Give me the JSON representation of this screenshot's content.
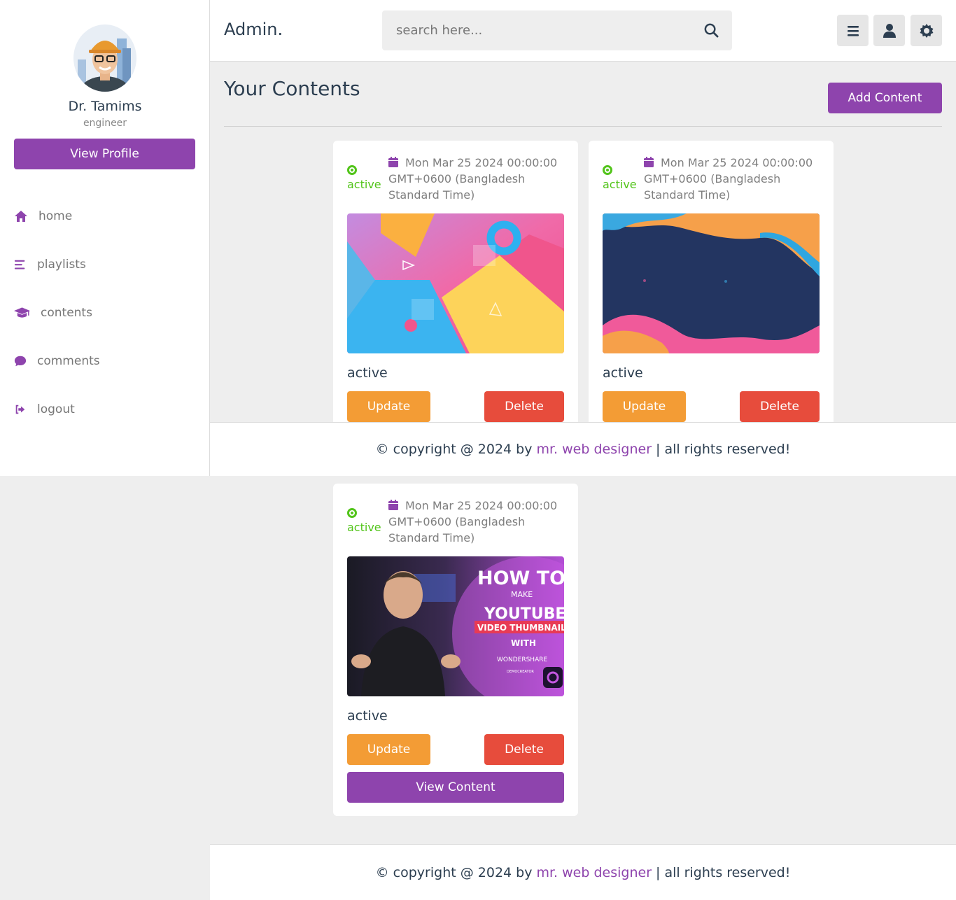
{
  "sidebar": {
    "profile_name": "Dr. Tamims",
    "profile_role": "engineer",
    "view_profile_label": "View Profile",
    "nav": [
      {
        "label": "home",
        "icon": "home-icon"
      },
      {
        "label": "playlists",
        "icon": "list-icon"
      },
      {
        "label": "contents",
        "icon": "graduation-cap-icon"
      },
      {
        "label": "comments",
        "icon": "comment-icon"
      },
      {
        "label": "logout",
        "icon": "logout-icon"
      }
    ]
  },
  "header": {
    "logo": "Admin.",
    "search_placeholder": "search here...",
    "buttons": [
      "menu-icon",
      "user-icon",
      "settings-icon"
    ]
  },
  "main": {
    "title": "Your Contents",
    "add_content_label": "Add Content",
    "cards": [
      {
        "status": "active",
        "date": "Mon Mar 25 2024 00:00:00 GMT+0600 (Bangladesh Standard Time)",
        "title": "active",
        "update_label": "Update",
        "delete_label": "Delete",
        "thumbnail": "abstract-geometric-shapes"
      },
      {
        "status": "active",
        "date": "Mon Mar 25 2024 00:00:00 GMT+0600 (Bangladesh Standard Time)",
        "title": "active",
        "update_label": "Update",
        "delete_label": "Delete",
        "thumbnail": "abstract-waves"
      },
      {
        "status": "active",
        "date": "Mon Mar 25 2024 00:00:00 GMT+0600 (Bangladesh Standard Time)",
        "title": "active",
        "update_label": "Update",
        "delete_label": "Delete",
        "view_label": "View Content",
        "thumbnail": "youtube-thumbnail",
        "thumb_text": {
          "line1": "HOW TO",
          "line2": "MAKE",
          "line3": "YOUTUBE",
          "line4": "VIDEO THUMBNAIL",
          "line5": "WITH",
          "line6": "WONDERSHARE",
          "line7": "DEMOCREATOR"
        }
      }
    ]
  },
  "footer": {
    "prefix": "© copyright @ 2024 by",
    "link": "mr. web designer",
    "suffix": "| all rights reserved!"
  },
  "colors": {
    "accent": "#8e44ad",
    "update": "#f39c35",
    "delete": "#e74c3c",
    "active": "#52c41a"
  }
}
